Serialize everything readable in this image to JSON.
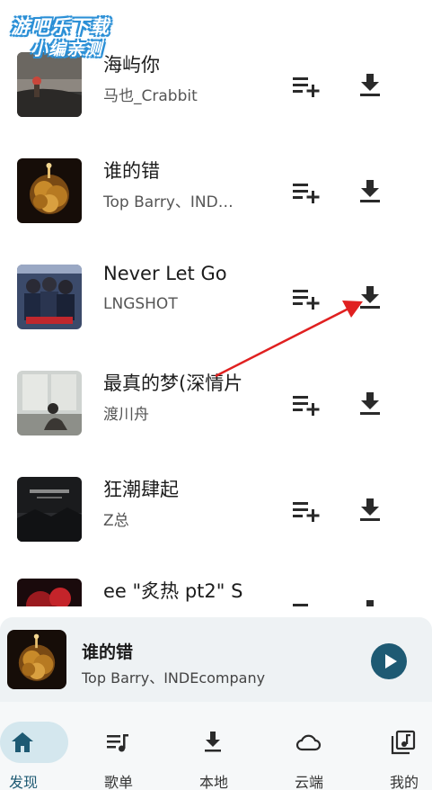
{
  "watermark": {
    "line1": "游吧乐下载",
    "line2": "小编亲测"
  },
  "songs": [
    {
      "title": "海屿你",
      "artist": "马也_Crabbit",
      "cover": "beach-cover"
    },
    {
      "title": "谁的错",
      "artist": "Top Barry、IND…",
      "cover": "gold-flower-cover"
    },
    {
      "title": "Never Let Go",
      "artist": "LNGSHOT",
      "cover": "group-photo-cover"
    },
    {
      "title": "最真的梦(深情片",
      "artist": "渡川舟",
      "cover": "woman-window-cover"
    },
    {
      "title": "狂潮肆起",
      "artist": "Z总",
      "cover": "dark-landscape-cover"
    },
    {
      "title": "ee \"炙热 pt2\" S",
      "artist": "",
      "cover": "red-abstract-cover"
    }
  ],
  "player": {
    "title": "谁的错",
    "artist": "Top Barry、INDEcompany"
  },
  "nav": [
    {
      "label": "发现",
      "icon": "home-icon",
      "active": true
    },
    {
      "label": "歌单",
      "icon": "playlist-icon",
      "active": false
    },
    {
      "label": "本地",
      "icon": "download-icon",
      "active": false
    },
    {
      "label": "云端",
      "icon": "cloud-icon",
      "active": false
    },
    {
      "label": "我的",
      "icon": "library-music-icon",
      "active": false
    }
  ],
  "colors": {
    "accent": "#1e5a73",
    "annotation_arrow": "#e02020",
    "player_bg": "#eef2f4"
  }
}
